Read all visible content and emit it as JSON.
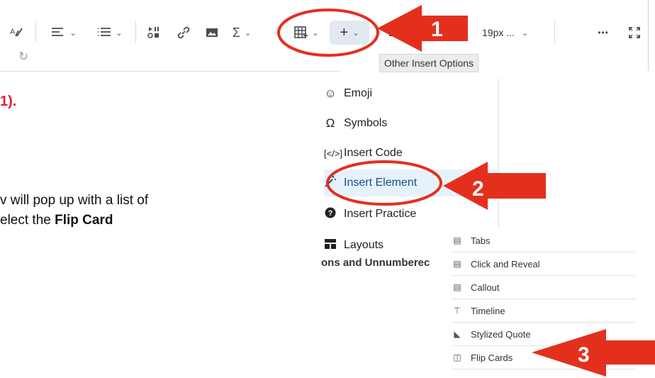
{
  "toolbar": {
    "font_size_value": "19px ...",
    "font_family_partial": "La",
    "more_label": "•••",
    "fullscreen_icon": "fullscreen-icon",
    "tooltip": "Other Insert Options"
  },
  "doc": {
    "fragment_top": "1).",
    "line1": "v will pop up with a list of",
    "line2_prefix": "elect the ",
    "line2_bold": "Flip Card",
    "line3_partial": "ons and Unnumberec"
  },
  "menu": {
    "items": [
      {
        "label": "Emoji",
        "icon": "emoji-icon"
      },
      {
        "label": "Symbols",
        "icon": "omega-icon"
      },
      {
        "label": "Insert Code",
        "icon": "code-icon"
      },
      {
        "label": "Insert Element",
        "icon": "magic-wand-icon"
      },
      {
        "label": "Insert Practice",
        "icon": "question-icon"
      },
      {
        "label": "Layouts",
        "icon": "layout-icon"
      }
    ]
  },
  "submenu": {
    "items": [
      {
        "label": "Tabs"
      },
      {
        "label": "Click and Reveal"
      },
      {
        "label": "Callout"
      },
      {
        "label": "Timeline"
      },
      {
        "label": "Stylized Quote"
      },
      {
        "label": "Flip Cards"
      }
    ]
  },
  "annotations": {
    "step1": "1",
    "step2": "2",
    "step3": "3",
    "arrow_color": "#e3301d"
  }
}
